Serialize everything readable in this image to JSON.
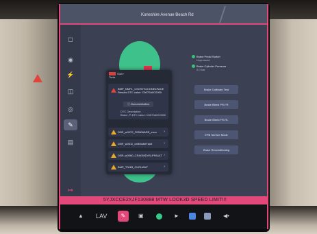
{
  "map": {
    "label": "Koneshire Avenue Beach Rd"
  },
  "sidebar": {
    "icons": [
      "car-icon",
      "driving-icon",
      "charging-icon",
      "seat-icon",
      "steering-icon",
      "wrench-icon",
      "file-icon",
      "exit-icon"
    ]
  },
  "panel": {
    "logo_text": "S3XY",
    "header_sub": "Tools",
    "alert": {
      "title": "BMP_NMPL_CSOSTS1CONE1PACE Results DTC value: C5070A0C0000",
      "documentation_label": "Documentation",
      "sub_line1": "DTC Description:",
      "sub_line2": "Brace, P-DTC value: C5070A0C0000"
    },
    "rows": [
      {
        "label": "DSR_w0072_FIRMWARE_error",
        "level": "warning"
      },
      {
        "label": "DSR_w0011_cellModelFault",
        "level": "warning"
      },
      {
        "label": "DSR_w0060_CRAGMDVSLPFAULT",
        "level": "warning"
      },
      {
        "label": "BMP_T0083_CURUANT",
        "level": "warning"
      }
    ]
  },
  "status": [
    {
      "label": "Brake Pedal Switch",
      "value": "Unpressed"
    },
    {
      "label": "Brake Cylinder Pressure",
      "value": "0.0 bar"
    }
  ],
  "actions": [
    "Brake Calibrate Test",
    "Brake Bleed PR-FR",
    "Brake Bleed FR-RL",
    "EPB Service Mode",
    "Brake Reconditioning"
  ],
  "vin_bar": "5YJXCCE2XJF130888  MTW LOOK3D  SPEED LIMIT!!!",
  "taskbar": {
    "climate_label": "LAV",
    "items": [
      "car-icon",
      "climate-icon",
      "app-icon",
      "camera-icon",
      "music-icon",
      "phone-icon",
      "notes-icon",
      "media-icon",
      "volume-icon"
    ]
  },
  "colors": {
    "accent": "#e2497a",
    "car_body": "#3ec18a",
    "warning": "#e6a829",
    "error": "#d9463c"
  }
}
